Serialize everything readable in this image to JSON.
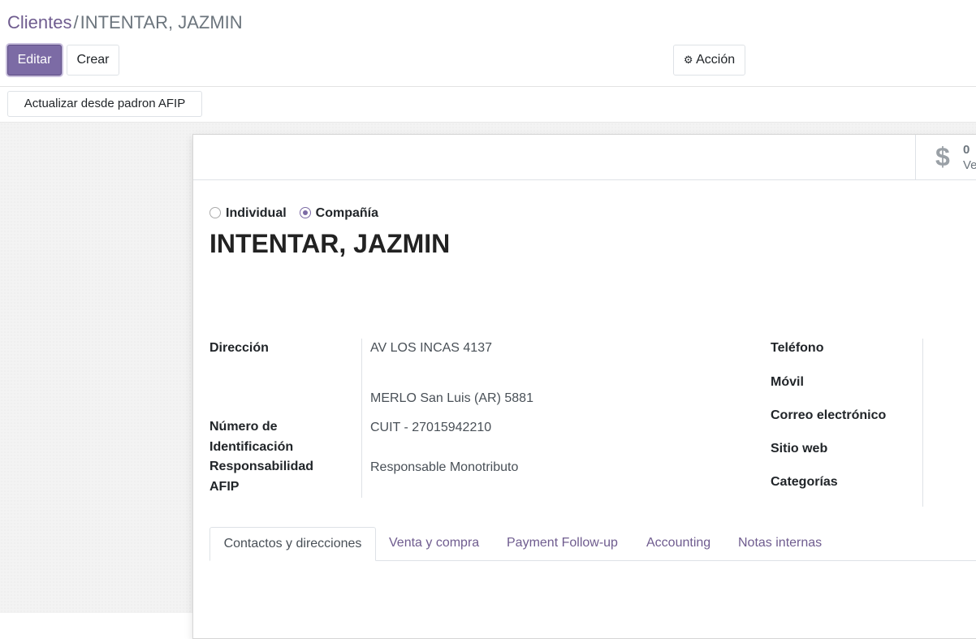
{
  "breadcrumb": {
    "parent": "Clientes",
    "separator": "/",
    "current": "INTENTAR, JAZMIN"
  },
  "toolbar": {
    "edit_label": "Editar",
    "create_label": "Crear",
    "action_icon": "gear-icon",
    "action_label": "Acción"
  },
  "header": {
    "update_afip_label": "Actualizar desde padron AFIP"
  },
  "stat_button": {
    "icon": "dollar-icon",
    "value": "0",
    "label": "Ve"
  },
  "company_type": {
    "options": [
      "Individual",
      "Compañía"
    ],
    "selected": "Compañía"
  },
  "partner": {
    "name": "INTENTAR, JAZMIN"
  },
  "fields_left": {
    "address_label": "Dirección",
    "street": "AV LOS INCAS 4137",
    "city_line": "MERLO  San Luis (AR)  5881",
    "id_label_1": "Número de",
    "id_label_2": "Identificación",
    "id_value": "CUIT - 27015942210",
    "resp_label_1": "Responsabilidad",
    "resp_label_2": "AFIP",
    "resp_value": "Responsable Monotributo"
  },
  "fields_right": {
    "phone_label": "Teléfono",
    "mobile_label": "Móvil",
    "email_label": "Correo electrónico",
    "website_label": "Sitio web",
    "categories_label": "Categorías"
  },
  "tabs": [
    "Contactos y direcciones",
    "Venta y compra",
    "Payment Follow-up",
    "Accounting",
    "Notas internas"
  ],
  "colors": {
    "primary": "#7c6ba5",
    "link": "#6f5c8f"
  }
}
